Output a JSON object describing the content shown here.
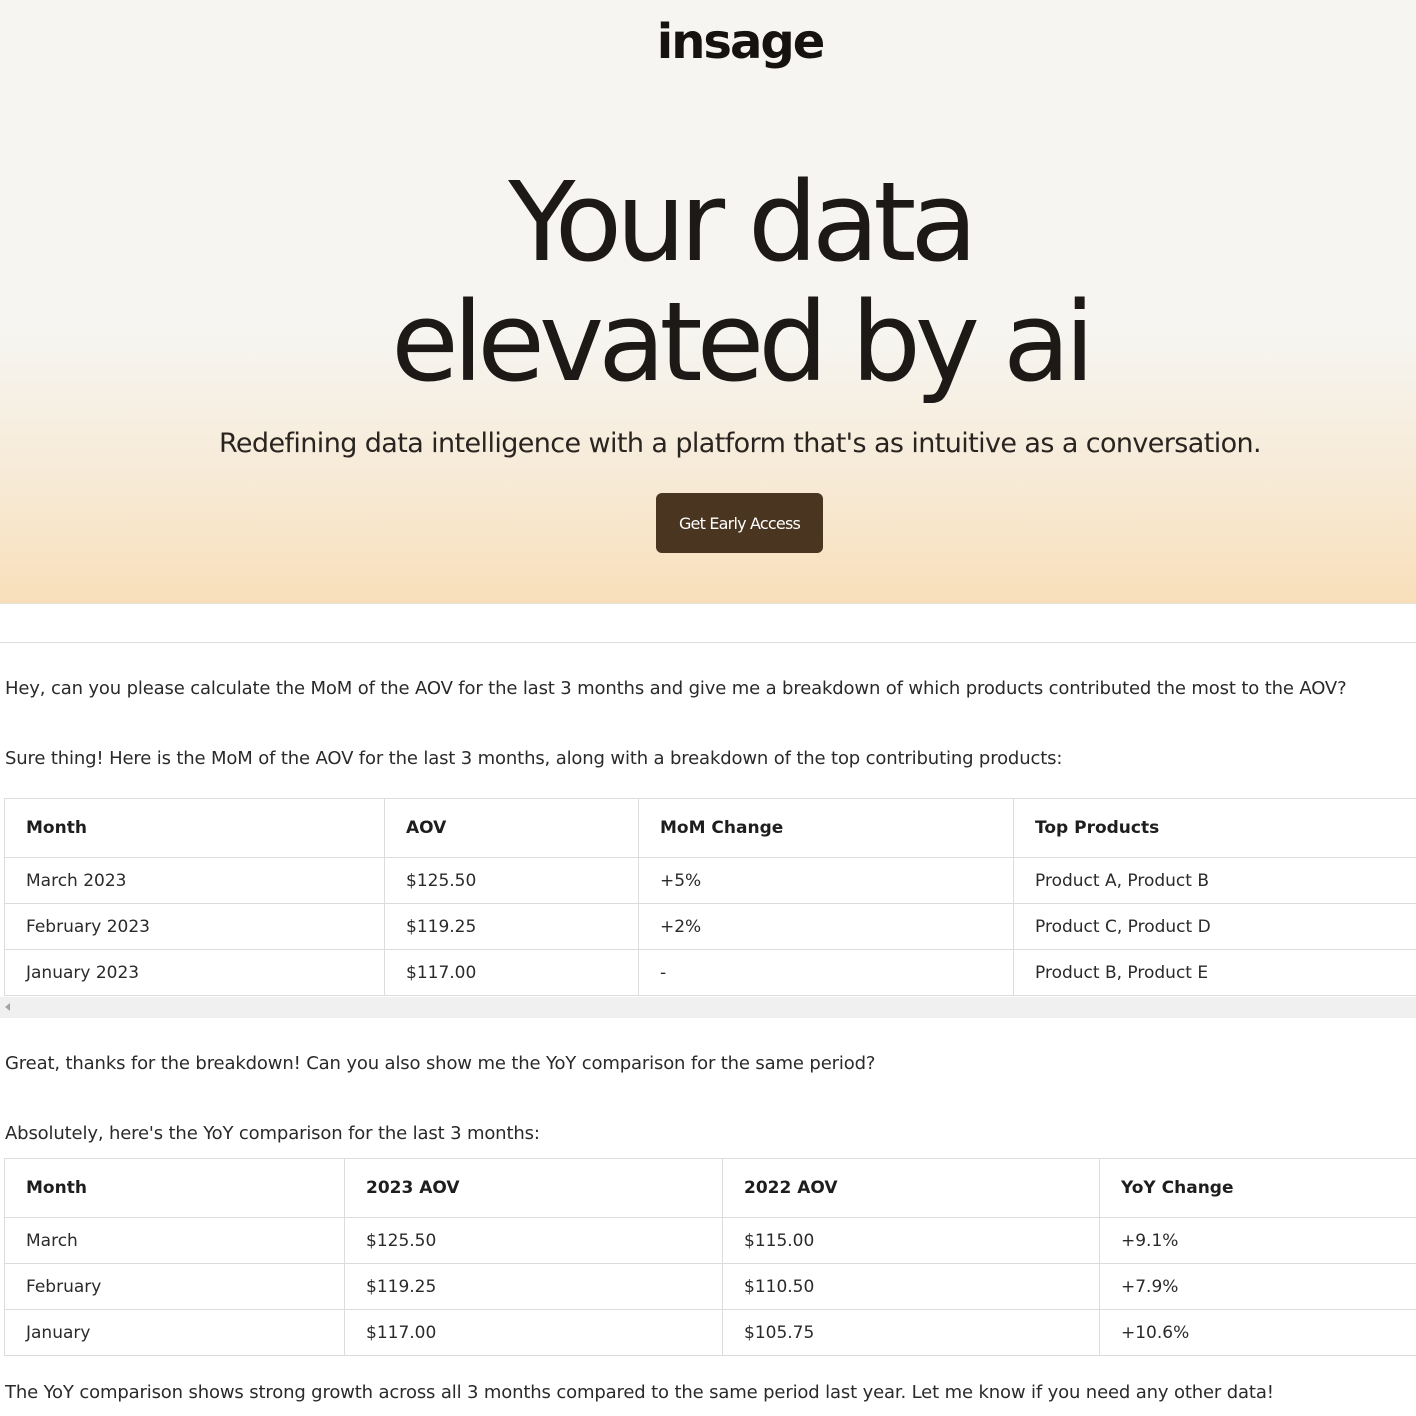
{
  "brand": {
    "logo": "insage"
  },
  "hero": {
    "headline_line1": "Your data",
    "headline_line2": "elevated by ai",
    "subheadline": "Redefining data intelligence with a platform that's as intuitive as a conversation.",
    "cta_label": "Get Early Access"
  },
  "conversation": {
    "user_message_1": "Hey, can you please calculate the MoM of the AOV for the last 3 months and give me a breakdown of which products contributed the most to the AOV?",
    "ai_message_1": "Sure thing! Here is the MoM of the AOV for the last 3 months, along with a breakdown of the top contributing products:",
    "user_message_2": "Great, thanks for the breakdown! Can you also show me the YoY comparison for the same period?",
    "ai_message_2": "Absolutely, here's the YoY comparison for the last 3 months:",
    "ai_message_3": "The YoY comparison shows strong growth across all 3 months compared to the same period last year. Let me know if you need any other data!"
  },
  "mom_table": {
    "headers": [
      "Month",
      "AOV",
      "MoM Change",
      "Top Products"
    ],
    "rows": [
      [
        "March 2023",
        "$125.50",
        "+5%",
        "Product A, Product B"
      ],
      [
        "February 2023",
        "$119.25",
        "+2%",
        "Product C, Product D"
      ],
      [
        "January 2023",
        "$117.00",
        "-",
        "Product B, Product E"
      ]
    ]
  },
  "yoy_table": {
    "headers": [
      "Month",
      "2023 AOV",
      "2022 AOV",
      "YoY Change"
    ],
    "rows": [
      [
        "March",
        "$125.50",
        "$115.00",
        "+9.1%"
      ],
      [
        "February",
        "$119.25",
        "$110.50",
        "+7.9%"
      ],
      [
        "January",
        "$117.00",
        "$105.75",
        "+10.6%"
      ]
    ]
  },
  "colors": {
    "cta_background": "#4a3520",
    "hero_gradient_bottom": "#f8dfba",
    "text": "#2a2a2a"
  },
  "icons": {
    "scroll_left": "scroll-left-arrow-icon"
  }
}
